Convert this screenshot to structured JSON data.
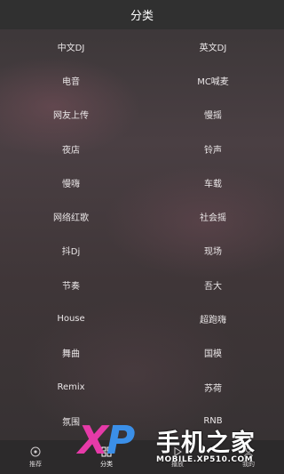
{
  "header": {
    "title": "分类"
  },
  "categories": [
    "中文DJ",
    "英文DJ",
    "电音",
    "MC喊麦",
    "网友上传",
    "慢摇",
    "夜店",
    "铃声",
    "慢嗨",
    "车载",
    "网络红歌",
    "社会摇",
    "抖Dj",
    "现场",
    "节奏",
    "吾大",
    "House",
    "超跑嗨",
    "舞曲",
    "国模",
    "Remix",
    "苏荷",
    "氛围",
    "RNB"
  ],
  "tabbar": {
    "tabs": [
      {
        "label": "推荐",
        "icon": "target-icon"
      },
      {
        "label": "分类",
        "icon": "grid-icon"
      },
      {
        "label": "播放",
        "icon": "play-icon"
      },
      {
        "label": "我的",
        "icon": "user-icon"
      }
    ],
    "active": "分类"
  },
  "watermark": {
    "xp": "XP",
    "brand": "手机之家",
    "url": "MOBILE.XP510.COM"
  }
}
